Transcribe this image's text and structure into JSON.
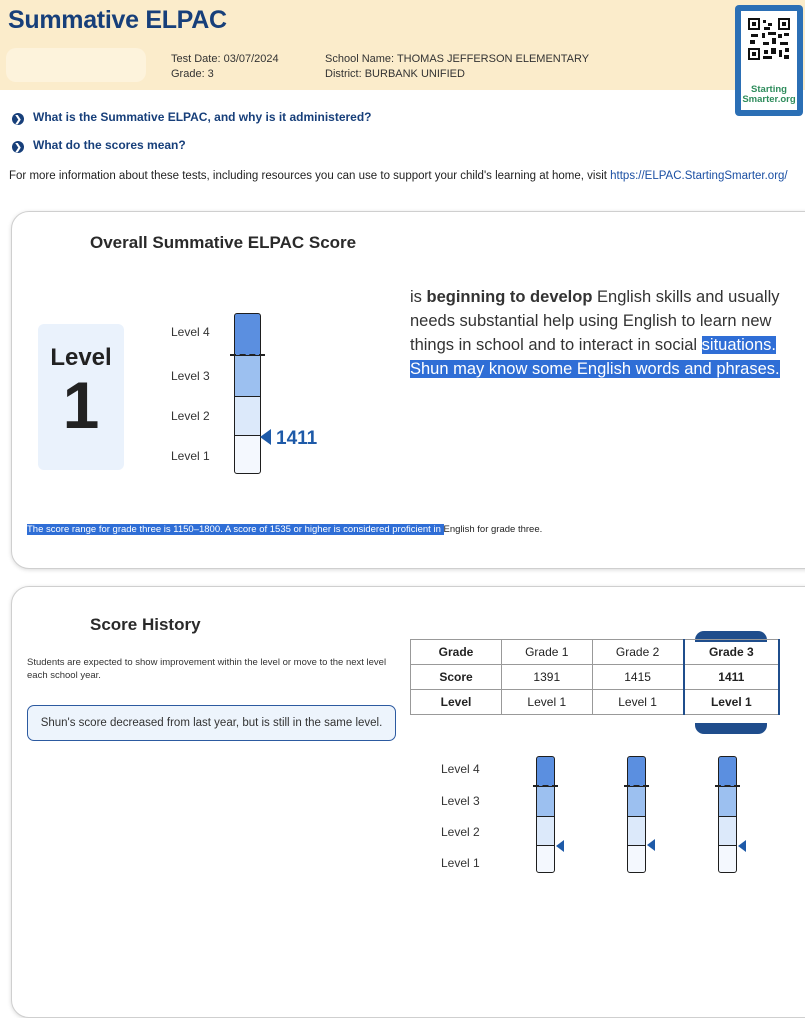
{
  "header": {
    "title": "Summative ELPAC",
    "test_date": "Test Date: 03/07/2024",
    "grade": "Grade: 3",
    "school": "School Name: THOMAS JEFFERSON ELEMENTARY",
    "district": "District: BURBANK UNIFIED",
    "qr_label_1": "Starting",
    "qr_label_2": "Smarter.org"
  },
  "faq": [
    {
      "label": "What is the Summative ELPAC, and why is it administered?"
    },
    {
      "label": "What do the scores mean?"
    }
  ],
  "info": {
    "text": "For more information about these tests, including resources you can use to support your child's learning at home, visit ",
    "link": "https://ELPAC.StartingSmarter.org/"
  },
  "overall": {
    "title": "Overall Summative ELPAC Score",
    "level_word": "Level",
    "level_number": "1",
    "level_labels": [
      "Level 4",
      "Level 3",
      "Level 2",
      "Level 1"
    ],
    "score": "1411",
    "desc_prefix": " is ",
    "desc_bold": "beginning to develop",
    "desc_rest": " English skills and usually needs substantial help using English to learn new things in school and to interact in social ",
    "desc_highlight": "situations. Shun may know some English words and phrases.",
    "range_highlight": "The score range for grade three is 1150–1800. A score of 1535 or higher is considered proficient in ",
    "range_rest": "English for grade three."
  },
  "history": {
    "title": "Score History",
    "intro": "Students are expected to show improvement within the level or move to the next level each school year.",
    "callout": "Shun's score decreased from last year, but is still in the same level.",
    "table": {
      "row_headers": [
        "Grade",
        "Score",
        "Level"
      ],
      "grades": [
        "Grade 1",
        "Grade 2",
        "Grade 3"
      ],
      "scores": [
        "1391",
        "1415",
        "1411"
      ],
      "levels": [
        "Level 1",
        "Level 1",
        "Level 1"
      ]
    },
    "level_labels": [
      "Level 4",
      "Level 3",
      "Level 2",
      "Level 1"
    ]
  },
  "colors": {
    "level4": "#5b8fe0",
    "level3": "#9cc0f0",
    "level2": "#dce9fa",
    "level1": "#f4f8fe",
    "accent": "#1f4d8c"
  }
}
